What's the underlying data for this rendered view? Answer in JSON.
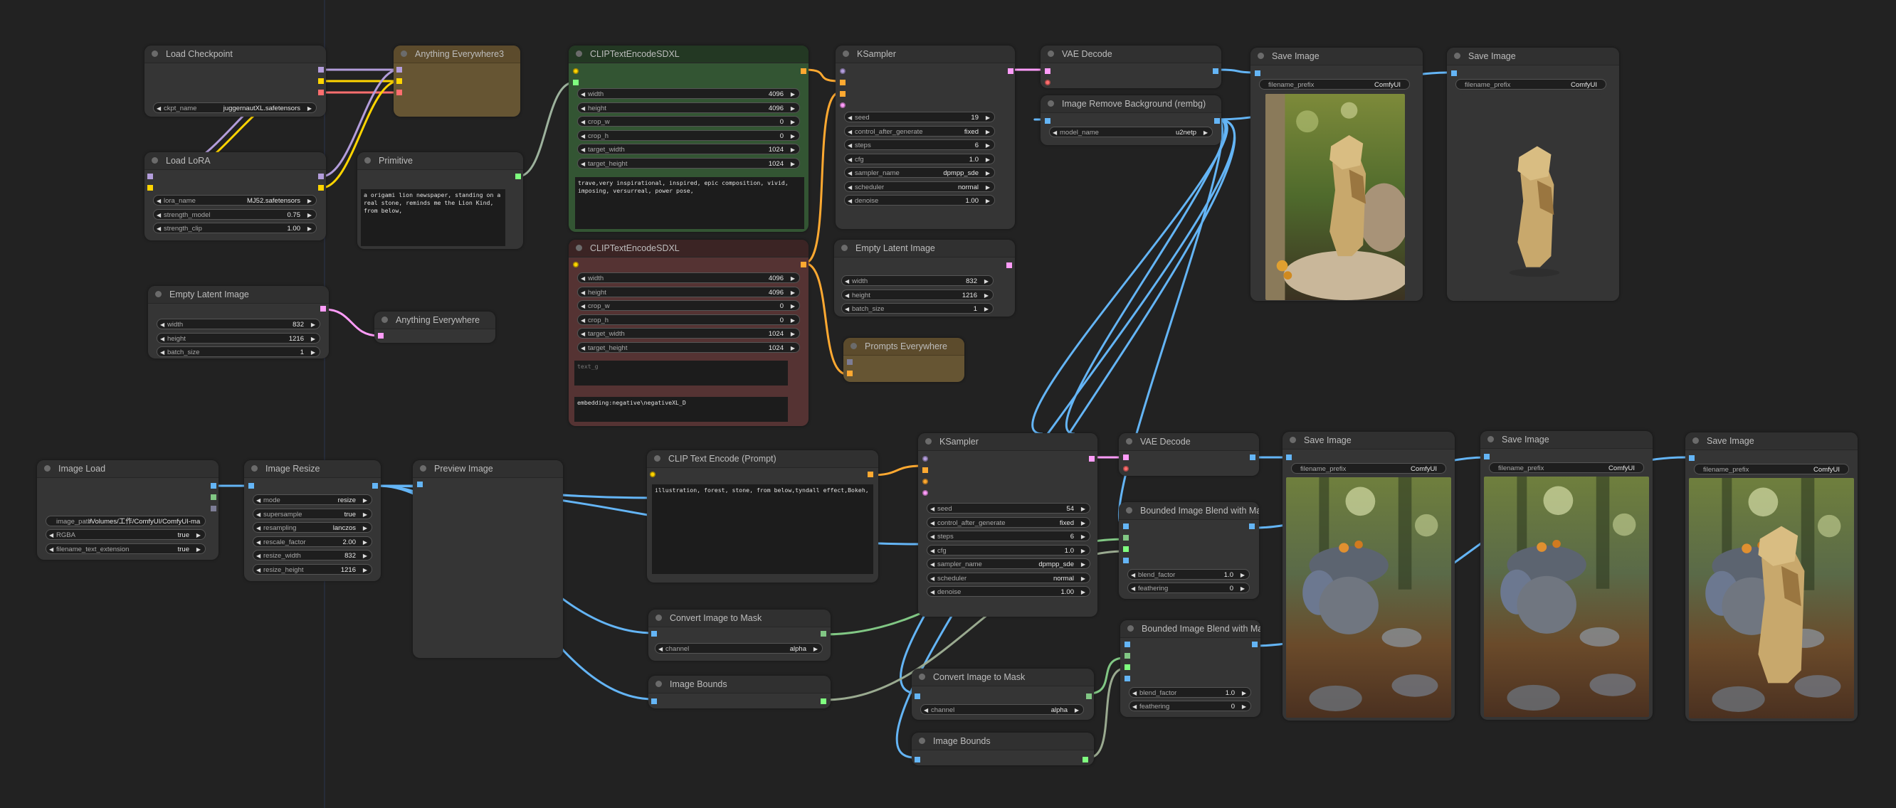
{
  "app": {
    "name": "ComfyUI node graph"
  },
  "colors": {
    "background": "#222222",
    "node_body": "#353535",
    "node_green": "#335533",
    "node_red": "#553333",
    "node_brown": "#665533",
    "link_model": "#b39ddb",
    "link_clip": "#ffd500",
    "link_vae": "#ff6e6e",
    "link_conditioning": "#ffa931",
    "link_latent": "#ff9cf9",
    "link_image": "#64b5f6",
    "link_mask": "#81c784",
    "link_bounds": "#9aaa90",
    "link_string": "#9db29d"
  },
  "nodes": {
    "load_checkpoint": {
      "title": "Load Checkpoint",
      "widgets": [
        {
          "label": "ckpt_name",
          "value": "juggernautXL.safetensors"
        }
      ]
    },
    "load_lora": {
      "title": "Load LoRA",
      "widgets": [
        {
          "label": "lora_name",
          "value": "MJ52.safetensors"
        },
        {
          "label": "strength_model",
          "value": "0.75"
        },
        {
          "label": "strength_clip",
          "value": "1.00"
        }
      ]
    },
    "anything_everywhere3": {
      "title": "Anything Everywhere3"
    },
    "primitive": {
      "title": "Primitive",
      "text": "a origami lion newspaper, standing on a real stone, reminds me the Lion Kind, from below,"
    },
    "empty_latent_left": {
      "title": "Empty Latent Image",
      "widgets": [
        {
          "label": "width",
          "value": "832"
        },
        {
          "label": "height",
          "value": "1216"
        },
        {
          "label": "batch_size",
          "value": "1"
        }
      ]
    },
    "anything_everywhere": {
      "title": "Anything Everywhere"
    },
    "clip_sdxl_pos": {
      "title": "CLIPTextEncodeSDXL",
      "widgets": [
        {
          "label": "width",
          "value": "4096"
        },
        {
          "label": "height",
          "value": "4096"
        },
        {
          "label": "crop_w",
          "value": "0"
        },
        {
          "label": "crop_h",
          "value": "0"
        },
        {
          "label": "target_width",
          "value": "1024"
        },
        {
          "label": "target_height",
          "value": "1024"
        }
      ],
      "text": "trave,very inspirational, inspired, epic composition, vivid, imposing, versurreal, power pose,"
    },
    "clip_sdxl_neg": {
      "title": "CLIPTextEncodeSDXL",
      "widgets": [
        {
          "label": "width",
          "value": "4096"
        },
        {
          "label": "height",
          "value": "4096"
        },
        {
          "label": "crop_w",
          "value": "0"
        },
        {
          "label": "crop_h",
          "value": "0"
        },
        {
          "label": "target_width",
          "value": "1024"
        },
        {
          "label": "target_height",
          "value": "1024"
        }
      ],
      "text_g_placeholder": "text_g",
      "text_l": "embedding:negative\\negativeXL_D"
    },
    "ksampler_top": {
      "title": "KSampler",
      "widgets": [
        {
          "label": "seed",
          "value": "19"
        },
        {
          "label": "control_after_generate",
          "value": "fixed"
        },
        {
          "label": "steps",
          "value": "6"
        },
        {
          "label": "cfg",
          "value": "1.0"
        },
        {
          "label": "sampler_name",
          "value": "dpmpp_sde"
        },
        {
          "label": "scheduler",
          "value": "normal"
        },
        {
          "label": "denoise",
          "value": "1.00"
        }
      ]
    },
    "empty_latent_mid": {
      "title": "Empty Latent Image",
      "widgets": [
        {
          "label": "width",
          "value": "832"
        },
        {
          "label": "height",
          "value": "1216"
        },
        {
          "label": "batch_size",
          "value": "1"
        }
      ]
    },
    "prompts_everywhere": {
      "title": "Prompts Everywhere"
    },
    "vae_decode_top": {
      "title": "VAE Decode"
    },
    "rembg": {
      "title": "Image Remove Background (rembg)",
      "widgets": [
        {
          "label": "model_name",
          "value": "u2netp"
        }
      ]
    },
    "save_image_1": {
      "title": "Save Image",
      "filename_prefix_label": "filename_prefix",
      "filename_prefix": "ComfyUI",
      "image": "origami lion on rock in forest"
    },
    "save_image_2": {
      "title": "Save Image",
      "filename_prefix_label": "filename_prefix",
      "filename_prefix": "ComfyUI",
      "image": "origami lion with background removed"
    },
    "image_load": {
      "title": "Image Load",
      "image_path_label": "image_path",
      "image_path": "/Volumes/工作/ComfyUI/ComfyUI-ma",
      "widgets": [
        {
          "label": "RGBA",
          "value": "true"
        },
        {
          "label": "filename_text_extension",
          "value": "true"
        }
      ]
    },
    "image_resize": {
      "title": "Image Resize",
      "widgets": [
        {
          "label": "mode",
          "value": "resize"
        },
        {
          "label": "supersample",
          "value": "true"
        },
        {
          "label": "resampling",
          "value": "lanczos"
        },
        {
          "label": "rescale_factor",
          "value": "2.00"
        },
        {
          "label": "resize_width",
          "value": "832"
        },
        {
          "label": "resize_height",
          "value": "1216"
        }
      ]
    },
    "preview_image": {
      "title": "Preview Image"
    },
    "clip_text_encode": {
      "title": "CLIP Text Encode (Prompt)",
      "text": "illustration, forest, stone, from below,tyndall effect,Bokeh,"
    },
    "convert_mask_1": {
      "title": "Convert Image to Mask",
      "widgets": [
        {
          "label": "channel",
          "value": "alpha"
        }
      ]
    },
    "image_bounds_1": {
      "title": "Image Bounds"
    },
    "ksampler_bottom": {
      "title": "KSampler",
      "widgets": [
        {
          "label": "seed",
          "value": "54"
        },
        {
          "label": "control_after_generate",
          "value": "fixed"
        },
        {
          "label": "steps",
          "value": "6"
        },
        {
          "label": "cfg",
          "value": "1.0"
        },
        {
          "label": "sampler_name",
          "value": "dpmpp_sde"
        },
        {
          "label": "scheduler",
          "value": "normal"
        },
        {
          "label": "denoise",
          "value": "1.00"
        }
      ]
    },
    "convert_mask_2": {
      "title": "Convert Image to Mask",
      "widgets": [
        {
          "label": "channel",
          "value": "alpha"
        }
      ]
    },
    "image_bounds_2": {
      "title": "Image Bounds"
    },
    "vae_decode_bottom": {
      "title": "VAE Decode"
    },
    "blend_1": {
      "title": "Bounded Image Blend with Mask",
      "widgets": [
        {
          "label": "blend_factor",
          "value": "1.0"
        },
        {
          "label": "feathering",
          "value": "0"
        }
      ]
    },
    "blend_2": {
      "title": "Bounded Image Blend with Mask",
      "widgets": [
        {
          "label": "blend_factor",
          "value": "1.0"
        },
        {
          "label": "feathering",
          "value": "0"
        }
      ]
    },
    "save_image_3": {
      "title": "Save Image",
      "filename_prefix_label": "filename_prefix",
      "filename_prefix": "ComfyUI",
      "image": "forest stones scene"
    },
    "save_image_4": {
      "title": "Save Image",
      "filename_prefix_label": "filename_prefix",
      "filename_prefix": "ComfyUI",
      "image": "forest stones scene"
    },
    "save_image_5": {
      "title": "Save Image",
      "filename_prefix_label": "filename_prefix",
      "filename_prefix": "ComfyUI",
      "image": "origami lion composited in forest"
    }
  },
  "icons": {
    "arrow_left": "◀",
    "arrow_right": "▶"
  }
}
